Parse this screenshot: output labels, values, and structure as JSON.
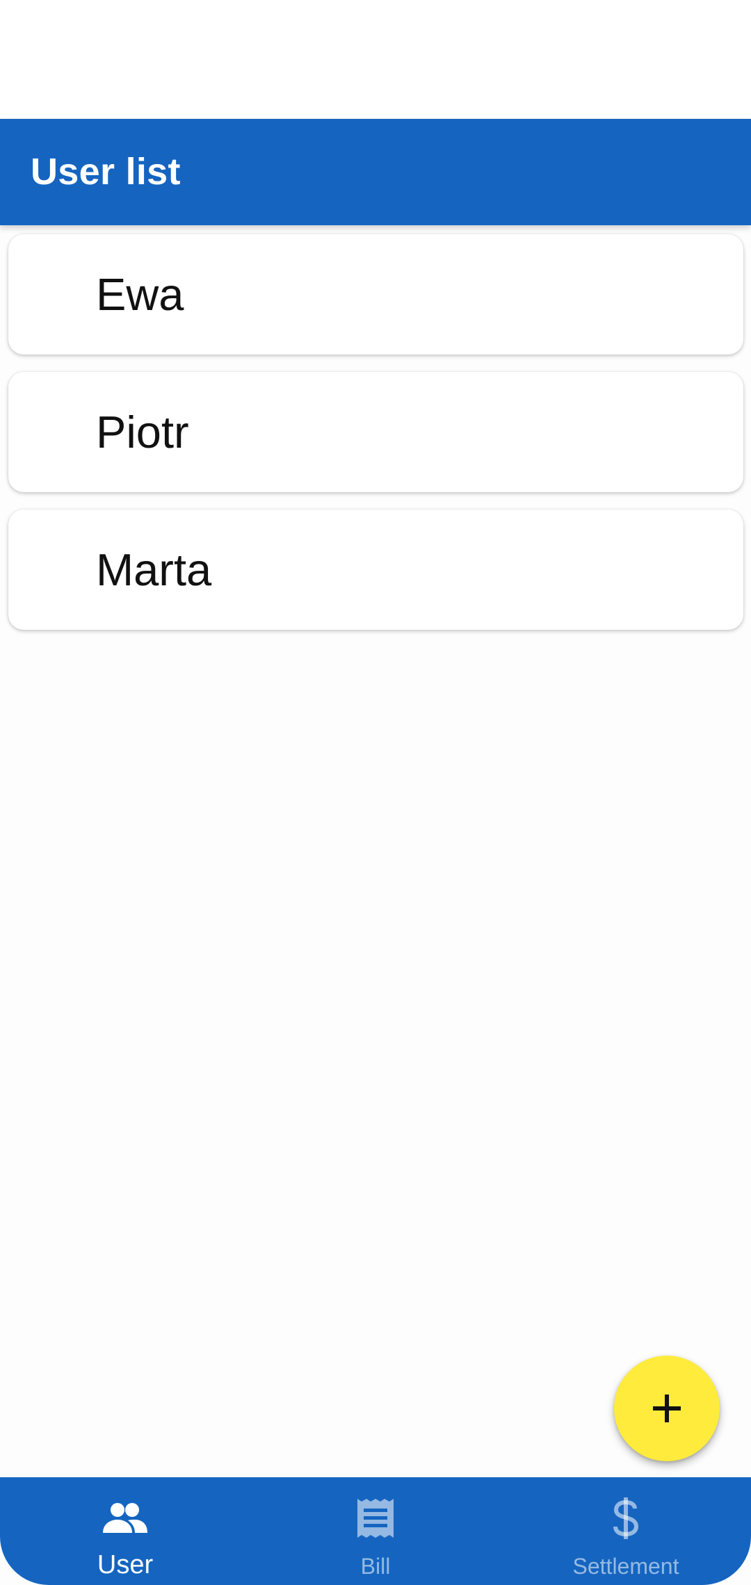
{
  "app_bar": {
    "title": "User list"
  },
  "users": [
    {
      "name": "Ewa"
    },
    {
      "name": "Piotr"
    },
    {
      "name": "Marta"
    }
  ],
  "fab": {
    "icon": "plus-icon"
  },
  "bottom_nav": {
    "items": [
      {
        "label": "User",
        "icon": "people-icon",
        "active": true
      },
      {
        "label": "Bill",
        "icon": "receipt-icon",
        "active": false
      },
      {
        "label": "Settlement",
        "icon": "dollar-icon",
        "active": false
      }
    ]
  },
  "colors": {
    "primary": "#1565c0",
    "accent": "#ffeb3b",
    "background": "#fdfdfd",
    "card": "#ffffff"
  }
}
